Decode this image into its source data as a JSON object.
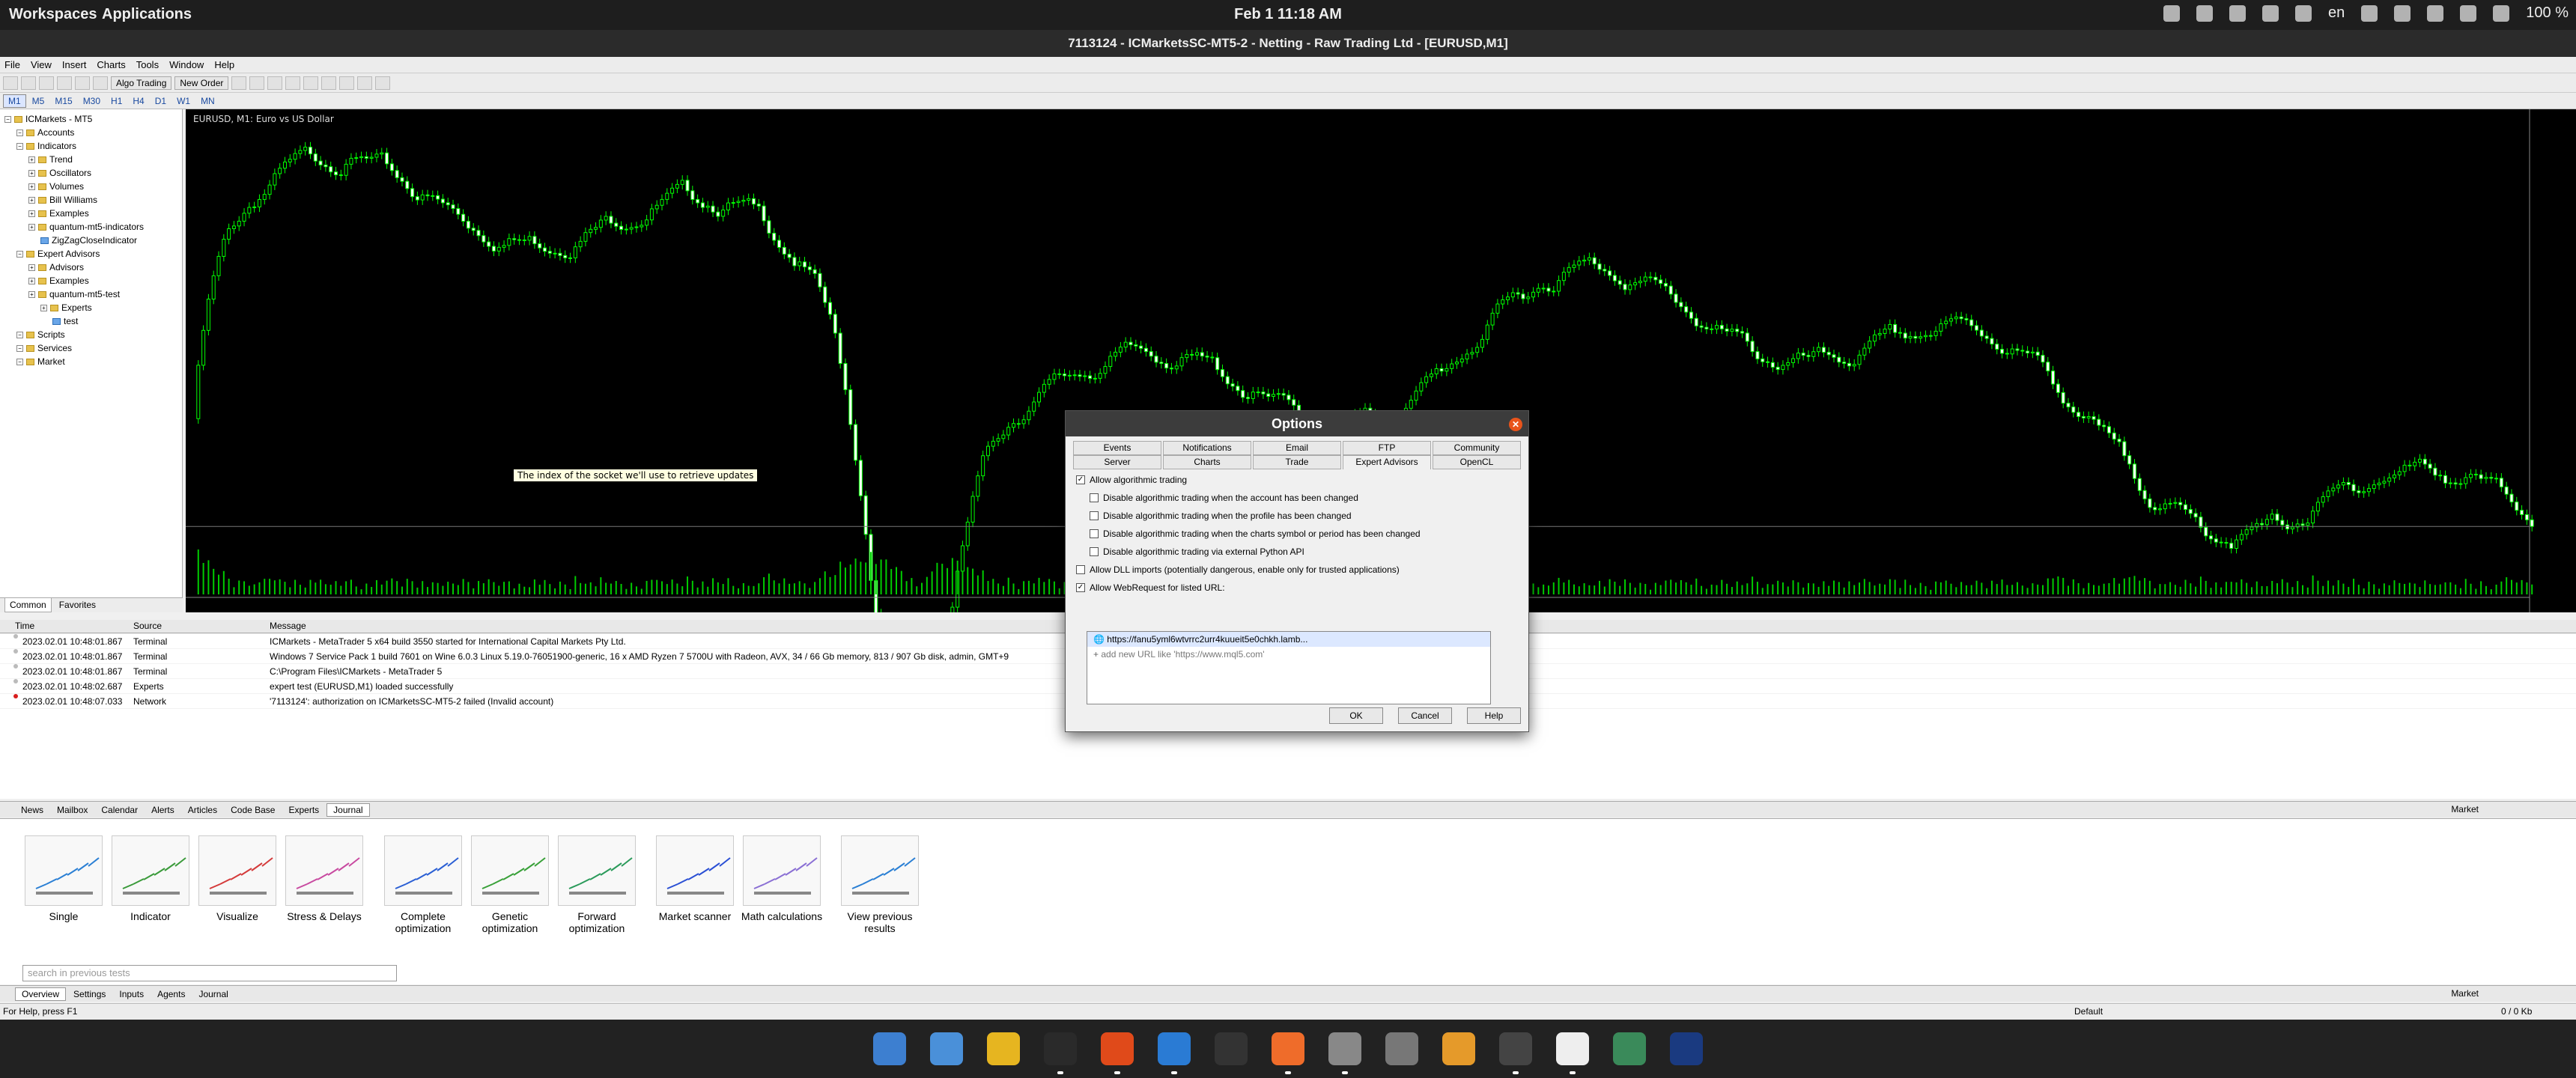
{
  "topbar": {
    "workspaces": "Workspaces",
    "applications": "Applications",
    "clock": "Feb 1  11:18 AM",
    "lang": "en",
    "battery": "100 %"
  },
  "window_title": "7113124 - ICMarketsSC-MT5-2 - Netting - Raw Trading Ltd - [EURUSD,M1]",
  "menu": [
    "File",
    "View",
    "Insert",
    "Charts",
    "Tools",
    "Window",
    "Help"
  ],
  "toolbar": {
    "algo_trading": "Algo Trading",
    "new_order": "New Order"
  },
  "timeframes": [
    "M1",
    "M5",
    "M15",
    "M30",
    "H1",
    "H4",
    "D1",
    "W1",
    "MN"
  ],
  "navigator": {
    "items": [
      {
        "label": "ICMarkets - MT5",
        "level": 0,
        "type": "root"
      },
      {
        "label": "Accounts",
        "level": 1,
        "type": "node"
      },
      {
        "label": "Indicators",
        "level": 1,
        "type": "node"
      },
      {
        "label": "Trend",
        "level": 2,
        "type": "folder"
      },
      {
        "label": "Oscillators",
        "level": 2,
        "type": "folder"
      },
      {
        "label": "Volumes",
        "level": 2,
        "type": "folder"
      },
      {
        "label": "Bill Williams",
        "level": 2,
        "type": "folder"
      },
      {
        "label": "Examples",
        "level": 2,
        "type": "folder"
      },
      {
        "label": "quantum-mt5-indicators",
        "level": 2,
        "type": "folder"
      },
      {
        "label": "ZigZagCloseIndicator",
        "level": 3,
        "type": "file"
      },
      {
        "label": "Expert Advisors",
        "level": 1,
        "type": "node"
      },
      {
        "label": "Advisors",
        "level": 2,
        "type": "folder"
      },
      {
        "label": "Examples",
        "level": 2,
        "type": "folder"
      },
      {
        "label": "quantum-mt5-test",
        "level": 2,
        "type": "folder"
      },
      {
        "label": "Experts",
        "level": 3,
        "type": "folder"
      },
      {
        "label": "test",
        "level": 4,
        "type": "file"
      },
      {
        "label": "Scripts",
        "level": 1,
        "type": "node"
      },
      {
        "label": "Services",
        "level": 1,
        "type": "node"
      },
      {
        "label": "Market",
        "level": 1,
        "type": "node"
      }
    ],
    "tabs": [
      "Common",
      "Favorites"
    ]
  },
  "chart": {
    "symbol_label": "EURUSD, M1:  Euro vs US Dollar",
    "tooltip": "The index of the socket we'll use to retrieve updates"
  },
  "terminal": {
    "headers": {
      "time": "Time",
      "source": "Source",
      "message": "Message"
    },
    "rows": [
      {
        "time": "2023.02.01 10:48:01.867",
        "source": "Terminal",
        "message": "ICMarkets - MetaTrader 5 x64 build 3550 started for International Capital Markets Pty Ltd.",
        "level": "info"
      },
      {
        "time": "2023.02.01 10:48:01.867",
        "source": "Terminal",
        "message": "Windows 7 Service Pack 1 build 7601 on Wine 6.0.3 Linux 5.19.0-76051900-generic, 16 x AMD Ryzen 7 5700U with Radeon, AVX, 34 / 66 Gb memory, 813 / 907 Gb disk, admin, GMT+9",
        "level": "info"
      },
      {
        "time": "2023.02.01 10:48:01.867",
        "source": "Terminal",
        "message": "C:\\Program Files\\ICMarkets - MetaTrader 5",
        "level": "info"
      },
      {
        "time": "2023.02.01 10:48:02.687",
        "source": "Experts",
        "message": "expert test (EURUSD,M1) loaded successfully",
        "level": "info"
      },
      {
        "time": "2023.02.01 10:48:07.033",
        "source": "Network",
        "message": "'7113124': authorization on ICMarketsSC-MT5-2 failed (Invalid account)",
        "level": "error"
      }
    ],
    "tabs": [
      "News",
      "Mailbox",
      "Calendar",
      "Alerts",
      "Articles",
      "Code Base",
      "Experts",
      "Journal"
    ],
    "active_tab": "Journal",
    "market": "Market"
  },
  "tester": {
    "cards": [
      {
        "label": "Single",
        "icon": "single-icon"
      },
      {
        "label": "Indicator",
        "icon": "indicator-icon"
      },
      {
        "label": "Visualize",
        "icon": "visualize-icon"
      },
      {
        "label": "Stress & Delays",
        "icon": "stress-icon"
      },
      {
        "label": "Complete optimization",
        "icon": "complete-optimization-icon"
      },
      {
        "label": "Genetic optimization",
        "icon": "genetic-optimization-icon"
      },
      {
        "label": "Forward optimization",
        "icon": "forward-optimization-icon"
      },
      {
        "label": "Market scanner",
        "icon": "market-scanner-icon"
      },
      {
        "label": "Math calculations",
        "icon": "math-calculations-icon"
      },
      {
        "label": "View previous results",
        "icon": "view-previous-icon"
      }
    ],
    "search_placeholder": "search in previous tests",
    "tabs": [
      "Overview",
      "Settings",
      "Inputs",
      "Agents",
      "Journal"
    ],
    "active_tab": "Overview",
    "market": "Market"
  },
  "status": {
    "help": "For Help, press F1",
    "profile": "Default",
    "traffic": "0 / 0 Kb"
  },
  "dialog": {
    "title": "Options",
    "tabs_top": [
      "Events",
      "Notifications",
      "Email",
      "FTP",
      "Community"
    ],
    "tabs_bottom": [
      "Server",
      "Charts",
      "Trade",
      "Expert Advisors",
      "OpenCL"
    ],
    "active_tab": "Expert Advisors",
    "options": [
      {
        "label": "Allow algorithmic trading",
        "checked": true,
        "indent": 0
      },
      {
        "label": "Disable algorithmic trading when the account has been changed",
        "checked": false,
        "indent": 1
      },
      {
        "label": "Disable algorithmic trading when the profile has been changed",
        "checked": false,
        "indent": 1
      },
      {
        "label": "Disable algorithmic trading when the charts symbol or period has been changed",
        "checked": false,
        "indent": 1
      },
      {
        "label": "Disable algorithmic trading via external Python API",
        "checked": false,
        "indent": 1
      },
      {
        "label": "Allow DLL imports (potentially dangerous, enable only for trusted applications)",
        "checked": false,
        "indent": 0
      },
      {
        "label": "Allow WebRequest for listed URL:",
        "checked": true,
        "indent": 0
      }
    ],
    "urls": [
      "https://fanu5yml6wtvrrc2urr4kuueit5e0chkh.lamb...",
      "add new URL like 'https://www.mql5.com'"
    ],
    "buttons": {
      "ok": "OK",
      "cancel": "Cancel",
      "help": "Help"
    }
  },
  "colors": {
    "chart_bg": "#000000",
    "candle": "#00ff00",
    "volume": "#00cc00"
  }
}
